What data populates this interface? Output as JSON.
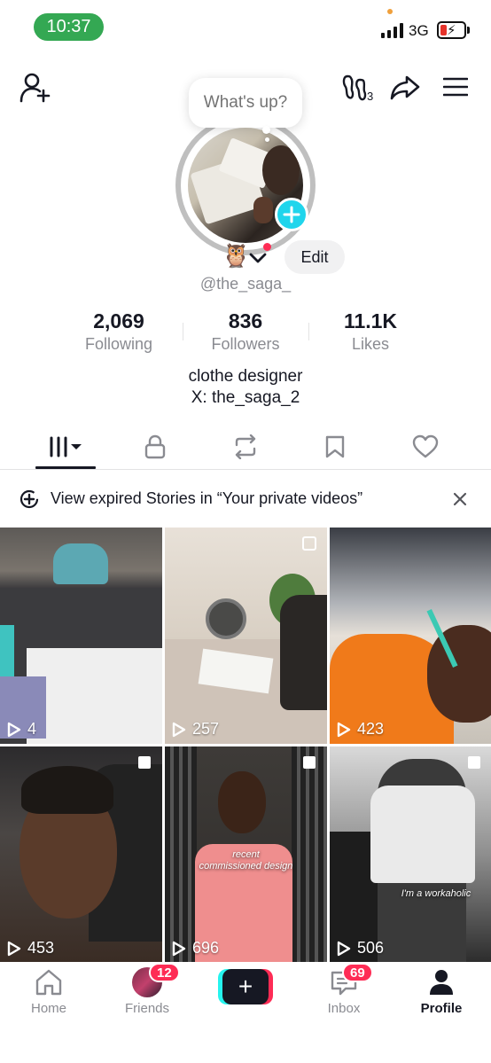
{
  "status_bar": {
    "time": "10:37",
    "network": "3G"
  },
  "header": {
    "bubble_text": "What's up?"
  },
  "profile": {
    "emoji": "🦉",
    "edit_label": "Edit",
    "username": "@the_saga_",
    "stats": [
      {
        "value": "2,069",
        "label": "Following"
      },
      {
        "value": "836",
        "label": "Followers"
      },
      {
        "value": "11.1K",
        "label": "Likes"
      }
    ],
    "bio_line1": "clothe designer",
    "bio_line2": "X: the_saga_2"
  },
  "tabs": [
    "videos",
    "private",
    "reposts",
    "favorites",
    "liked"
  ],
  "banner": {
    "text": "View expired Stories in “Your private videos”"
  },
  "videos": [
    {
      "views": "4"
    },
    {
      "views": "257"
    },
    {
      "views": "423"
    },
    {
      "views": "453"
    },
    {
      "views": "696",
      "caption_line1": "recent",
      "caption_line2": "commissioned design"
    },
    {
      "views": "506",
      "caption": "I'm a workaholic"
    }
  ],
  "bottom_nav": {
    "home": "Home",
    "friends": "Friends",
    "friends_badge": "12",
    "inbox": "Inbox",
    "inbox_badge": "69",
    "profile": "Profile"
  },
  "colors": {
    "accent_pink": "#fe2c55",
    "accent_cyan": "#25f4ee",
    "story_add": "#20d5ec",
    "time_pill": "#34a853"
  }
}
